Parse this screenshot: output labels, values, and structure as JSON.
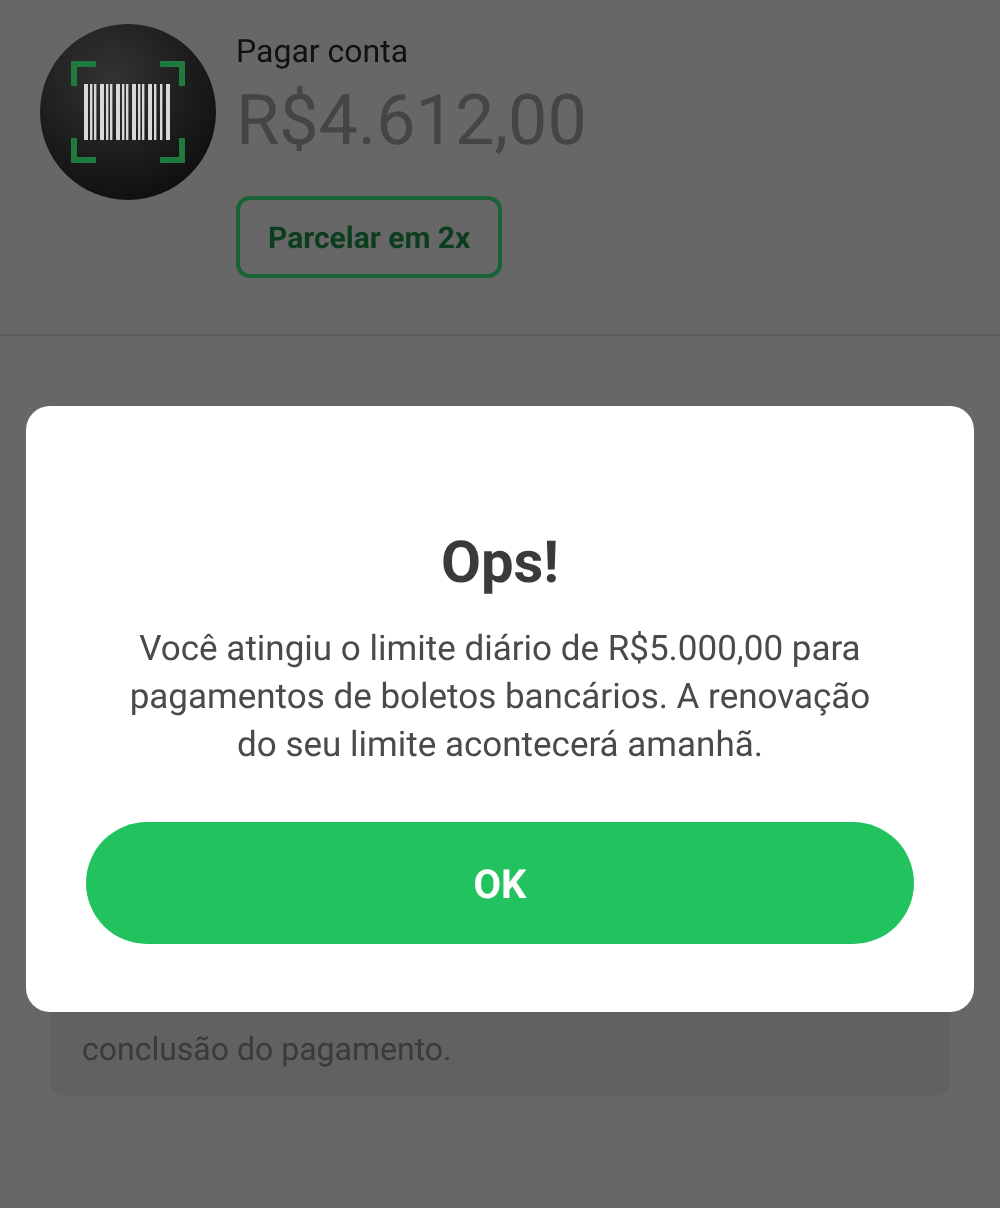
{
  "header": {
    "title": "Pagar conta",
    "amount": "R$4.612,00",
    "installment_button": "Parcelar em 2x"
  },
  "note": "conclusão do pagamento.",
  "dialog": {
    "title": "Ops!",
    "message": "Você atingiu o limite diário de R$5.000,00 para pagamentos de boletos bancários. A renovação do seu limite acontecerá amanhã.",
    "button": "OK"
  }
}
